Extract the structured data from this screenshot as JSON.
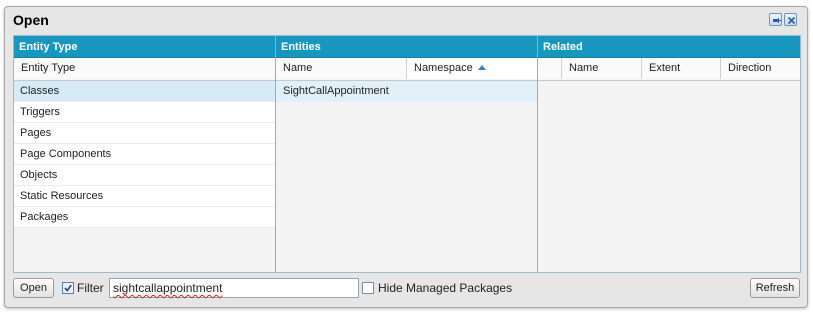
{
  "window": {
    "title": "Open"
  },
  "panels": {
    "entity_type": {
      "header": "Entity Type",
      "column": "Entity Type",
      "items": [
        "Classes",
        "Triggers",
        "Pages",
        "Page Components",
        "Objects",
        "Static Resources",
        "Packages"
      ],
      "selected": "Classes"
    },
    "entities": {
      "header": "Entities",
      "columns": [
        "Name",
        "Namespace"
      ],
      "sort": {
        "column": "Namespace",
        "direction": "ascending"
      },
      "rows": [
        {
          "name": "SightCallAppointment",
          "namespace": ""
        }
      ]
    },
    "related": {
      "header": "Related",
      "columns": [
        "Name",
        "Extent",
        "Direction"
      ],
      "rows": []
    }
  },
  "footer": {
    "open_label": "Open",
    "filter_checked": true,
    "filter_label": "Filter",
    "filter_value": "sightcallappointment",
    "hide_managed_checked": false,
    "hide_managed_label": "Hide Managed Packages",
    "refresh_label": "Refresh"
  },
  "colors": {
    "panel_header": "#1797c0",
    "selected_row": "#d5ebf7"
  }
}
